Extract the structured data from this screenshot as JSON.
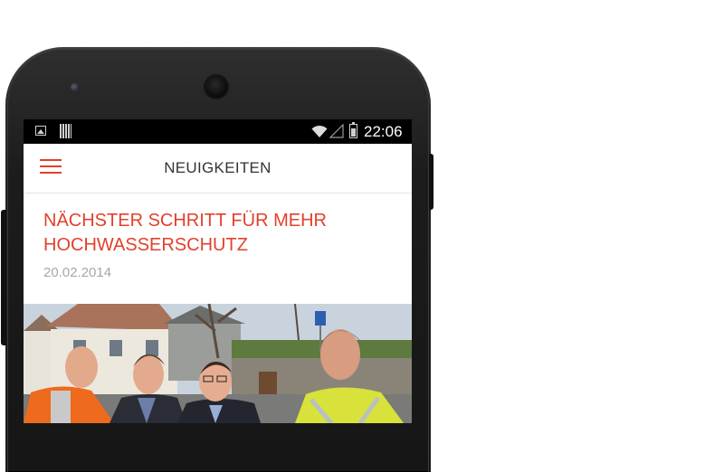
{
  "status_bar": {
    "time": "22:06",
    "icons": [
      "image-notification-icon",
      "barcode-notification-icon",
      "wifi-icon",
      "cell-signal-icon",
      "battery-icon"
    ]
  },
  "app_bar": {
    "title": "NEUIGKEITEN",
    "menu_icon": "hamburger-menu-icon"
  },
  "article": {
    "title_line1": "NÄCHSTER SCHRITT FÜR MEHR",
    "title_line2": "HOCHWASSERSCHUTZ",
    "date": "20.02.2014",
    "image": "group-photo"
  },
  "colors": {
    "accent": "#e2412b",
    "date_text": "#a7a7a7",
    "title_text": "#333333",
    "status_bar": "#000000"
  }
}
